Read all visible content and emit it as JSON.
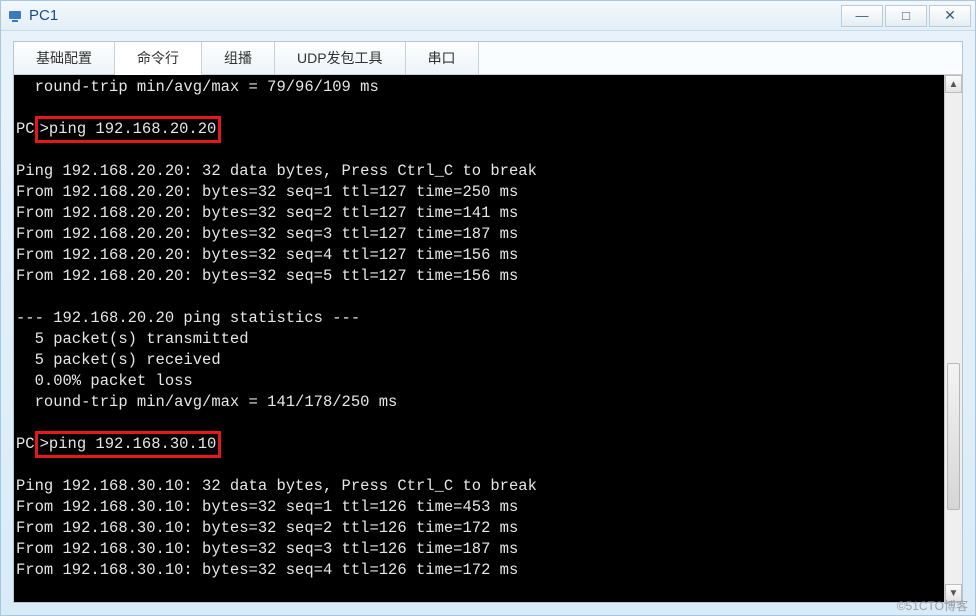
{
  "window": {
    "title": "PC1"
  },
  "tabs": {
    "items": [
      {
        "label": "基础配置"
      },
      {
        "label": "命令行"
      },
      {
        "label": "组播"
      },
      {
        "label": "UDP发包工具"
      },
      {
        "label": "串口"
      }
    ],
    "activeIndex": 1
  },
  "terminal": {
    "lines": [
      {
        "t": "  round-trip min/avg/max = 79/96/109 ms",
        "hl": false,
        "prompt": false
      },
      {
        "t": "",
        "hl": false,
        "prompt": false
      },
      {
        "t": "ping 192.168.20.20",
        "hl": true,
        "prompt": true
      },
      {
        "t": "",
        "hl": false,
        "prompt": false
      },
      {
        "t": "Ping 192.168.20.20: 32 data bytes, Press Ctrl_C to break",
        "hl": false,
        "prompt": false
      },
      {
        "t": "From 192.168.20.20: bytes=32 seq=1 ttl=127 time=250 ms",
        "hl": false,
        "prompt": false
      },
      {
        "t": "From 192.168.20.20: bytes=32 seq=2 ttl=127 time=141 ms",
        "hl": false,
        "prompt": false
      },
      {
        "t": "From 192.168.20.20: bytes=32 seq=3 ttl=127 time=187 ms",
        "hl": false,
        "prompt": false
      },
      {
        "t": "From 192.168.20.20: bytes=32 seq=4 ttl=127 time=156 ms",
        "hl": false,
        "prompt": false
      },
      {
        "t": "From 192.168.20.20: bytes=32 seq=5 ttl=127 time=156 ms",
        "hl": false,
        "prompt": false
      },
      {
        "t": "",
        "hl": false,
        "prompt": false
      },
      {
        "t": "--- 192.168.20.20 ping statistics ---",
        "hl": false,
        "prompt": false
      },
      {
        "t": "  5 packet(s) transmitted",
        "hl": false,
        "prompt": false
      },
      {
        "t": "  5 packet(s) received",
        "hl": false,
        "prompt": false
      },
      {
        "t": "  0.00% packet loss",
        "hl": false,
        "prompt": false
      },
      {
        "t": "  round-trip min/avg/max = 141/178/250 ms",
        "hl": false,
        "prompt": false
      },
      {
        "t": "",
        "hl": false,
        "prompt": false
      },
      {
        "t": "ping 192.168.30.10",
        "hl": true,
        "prompt": true
      },
      {
        "t": "",
        "hl": false,
        "prompt": false
      },
      {
        "t": "Ping 192.168.30.10: 32 data bytes, Press Ctrl_C to break",
        "hl": false,
        "prompt": false
      },
      {
        "t": "From 192.168.30.10: bytes=32 seq=1 ttl=126 time=453 ms",
        "hl": false,
        "prompt": false
      },
      {
        "t": "From 192.168.30.10: bytes=32 seq=2 ttl=126 time=172 ms",
        "hl": false,
        "prompt": false
      },
      {
        "t": "From 192.168.30.10: bytes=32 seq=3 ttl=126 time=187 ms",
        "hl": false,
        "prompt": false
      },
      {
        "t": "From 192.168.30.10: bytes=32 seq=4 ttl=126 time=172 ms",
        "hl": false,
        "prompt": false
      }
    ],
    "prompt": "PC>"
  },
  "watermark": "©51CTO博客"
}
